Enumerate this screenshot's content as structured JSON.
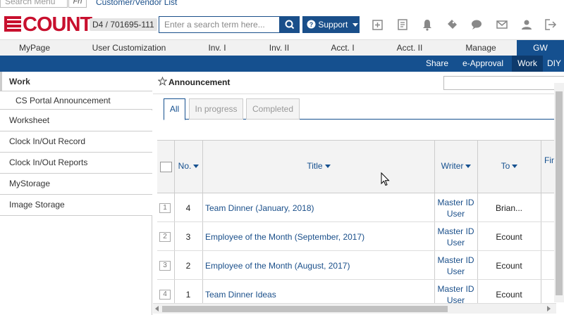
{
  "top_strip": {
    "search_menu_placeholder": "Search Menu",
    "fn_label": "Fn",
    "customer_vendor_link": "Customer/Vendor List"
  },
  "header": {
    "logo_text": "COUNT",
    "company_code": "D4 / 701695-111",
    "search_placeholder": "Enter a search term here...",
    "support_label": "Support",
    "icons": [
      "new-window-icon",
      "document-icon",
      "bell-icon",
      "ticket-icon",
      "chat-icon",
      "mail-icon",
      "user-icon",
      "logout-icon"
    ]
  },
  "main_menu": [
    "MyPage",
    "User Customization",
    "Inv. I",
    "Inv. II",
    "Acct. I",
    "Acct. II",
    "Manage",
    "GW"
  ],
  "main_menu_active": "GW",
  "sub_menu": [
    "Share",
    "e-Approval",
    "Work",
    "DIY"
  ],
  "sub_menu_active": "Work",
  "sidebar": {
    "section_title": "Work",
    "child_item": "CS Portal Announcement",
    "items": [
      "Worksheet",
      "Clock In/Out Record",
      "Clock In/Out Reports",
      "MyStorage",
      "Image Storage"
    ]
  },
  "content": {
    "title": "Announcement",
    "tabs": [
      "All",
      "In progress",
      "Completed"
    ],
    "active_tab": "All",
    "table": {
      "headers": [
        "No.",
        "Title",
        "Writer",
        "To",
        "Fin"
      ],
      "rows": [
        {
          "row_index": "1",
          "no": "4",
          "title": "Team Dinner (January, 2018)",
          "writer_line1": "Master ID",
          "writer_line2": "User",
          "to": "Brian..."
        },
        {
          "row_index": "2",
          "no": "3",
          "title": "Employee of the Month (September, 2017)",
          "writer_line1": "Master ID",
          "writer_line2": "User",
          "to": "Ecount"
        },
        {
          "row_index": "3",
          "no": "2",
          "title": "Employee of the Month (August, 2017)",
          "writer_line1": "Master ID",
          "writer_line2": "User",
          "to": "Ecount"
        },
        {
          "row_index": "4",
          "no": "1",
          "title": "Team Dinner Ideas",
          "writer_line1": "Master ID",
          "writer_line2": "User",
          "to": "Ecount"
        }
      ]
    }
  },
  "colors": {
    "brand_red": "#c8102e",
    "primary_blue": "#15508f",
    "link_blue": "#1a4f8a"
  }
}
